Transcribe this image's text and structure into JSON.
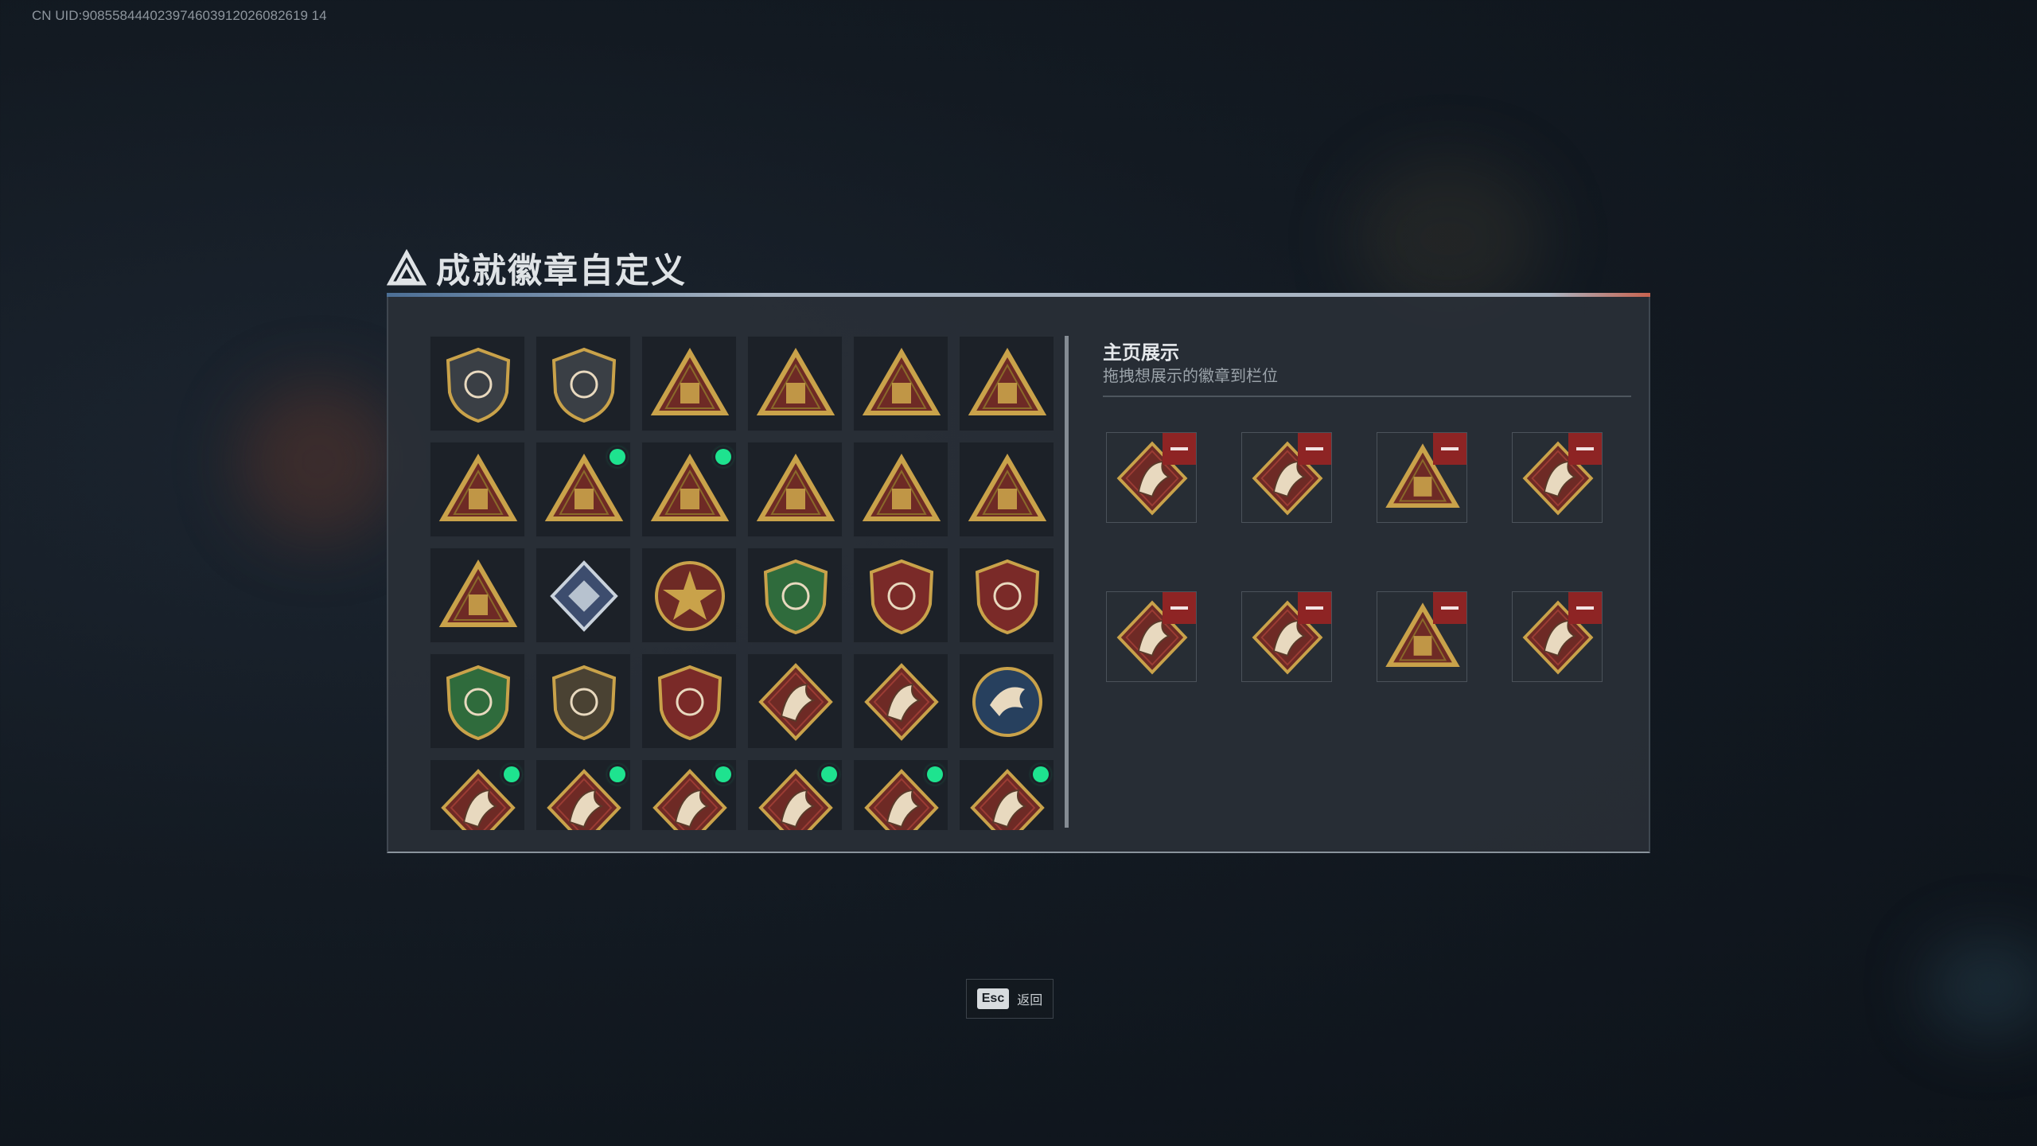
{
  "uid_text": "CN UID:908558444023974603912026082619 14",
  "title": "成就徽章自定义",
  "showcase": {
    "title": "主页展示",
    "subtitle": "拖拽想展示的徽章到栏位"
  },
  "footer": {
    "key": "Esc",
    "label": "返回"
  },
  "colors": {
    "accent_new": "#1ee38f",
    "remove_red": "#8e2424",
    "gold": "#c9a24a",
    "maroon": "#6e2a25"
  },
  "badge_grid": [
    {
      "icon": "gray-shield-triangle-badge-icon",
      "new": false
    },
    {
      "icon": "helicopter-shield-badge-icon",
      "new": false
    },
    {
      "icon": "gold-triangle-s7-badge-icon",
      "new": false
    },
    {
      "icon": "gold-triangle-s8-badge-icon",
      "new": false
    },
    {
      "icon": "gold-winged-triangle-s9-badge-icon",
      "new": false
    },
    {
      "icon": "gold-triangle-hand-badge-icon",
      "new": false
    },
    {
      "icon": "gold-triangle-number-one-badge-icon",
      "new": false
    },
    {
      "icon": "gold-triangle-bottle-badge-icon",
      "new": true
    },
    {
      "icon": "gold-triangle-crest-badge-icon",
      "new": true
    },
    {
      "icon": "gold-triangle-soldiers-badge-icon",
      "new": false
    },
    {
      "icon": "gold-triangle-group-badge-icon",
      "new": false
    },
    {
      "icon": "gold-triangle-rocket-badge-icon",
      "new": false
    },
    {
      "icon": "gold-triangle-dragon-badge-icon",
      "new": false
    },
    {
      "icon": "silver-diamond-cube-badge-icon",
      "new": false
    },
    {
      "icon": "gold-star-medal-badge-icon",
      "new": false
    },
    {
      "icon": "green-shield-emblem-badge-icon",
      "new": false
    },
    {
      "icon": "stars-shield-crest-badge-icon",
      "new": false
    },
    {
      "icon": "stars-shield-star-badge-icon",
      "new": false
    },
    {
      "icon": "green-crosshair-shield-badge-icon",
      "new": false
    },
    {
      "icon": "gold-rifle-shield-badge-icon",
      "new": false
    },
    {
      "icon": "wings-sword-shield-badge-icon",
      "new": false
    },
    {
      "icon": "red-diamond-wolf-badge-icon",
      "new": false
    },
    {
      "icon": "red-diamond-wolf-roar-badge-icon",
      "new": false
    },
    {
      "icon": "blue-circle-eagle-badge-icon",
      "new": false
    },
    {
      "icon": "red-diamond-dragon-badge-icon",
      "new": true
    },
    {
      "icon": "red-diamond-dragon-badge-icon",
      "new": true
    },
    {
      "icon": "red-diamond-runner-badge-icon",
      "new": true
    },
    {
      "icon": "red-diamond-horse-badge-icon",
      "new": true
    },
    {
      "icon": "red-diamond-horse-badge-icon",
      "new": true
    },
    {
      "icon": "red-diamond-syringe-badge-icon",
      "new": true
    }
  ],
  "showcase_slots": [
    {
      "icon": "red-diamond-horse-badge-icon"
    },
    {
      "icon": "red-diamond-dragon-badge-icon"
    },
    {
      "icon": "gold-triangle-bottle-badge-icon"
    },
    {
      "icon": "red-diamond-syringe-badge-icon"
    },
    {
      "icon": "red-diamond-horse-badge-icon"
    },
    {
      "icon": "red-diamond-dragon-badge-icon"
    },
    {
      "icon": "gold-triangle-crest-badge-icon"
    },
    {
      "icon": "red-diamond-runner-badge-icon"
    }
  ]
}
